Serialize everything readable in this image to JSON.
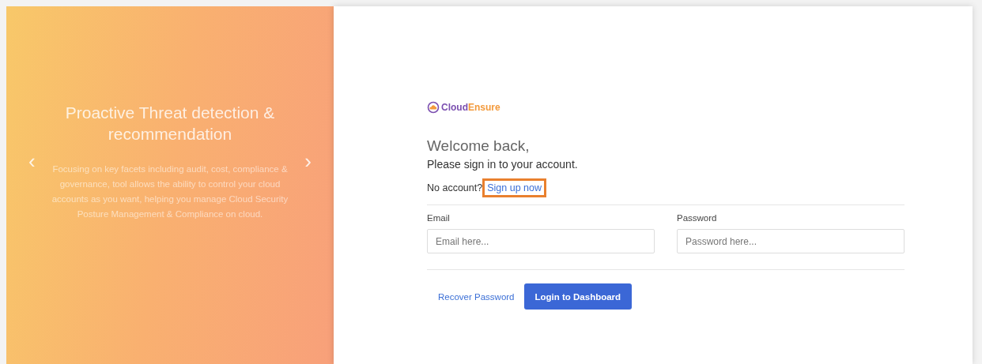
{
  "carousel": {
    "title": "Proactive Threat detection & recommendation",
    "text": "Focusing on key facets including audit, cost, compliance & governance, tool allows the ability to control your cloud accounts as you want, helping you manage Cloud Security Posture Management & Compliance on cloud.",
    "prev": "‹",
    "next": "›"
  },
  "logo": {
    "part_1": "Cloud",
    "part_2": "Ensure"
  },
  "heading": "Welcome back,",
  "subheading": "Please sign in to your account.",
  "signup": {
    "prompt": "No account?",
    "link": "Sign up now",
    "highlighted": true
  },
  "fields": [
    {
      "label": "Email",
      "placeholder": "Email here..."
    },
    {
      "label": "Password",
      "placeholder": "Password here..."
    }
  ],
  "recover_link": "Recover Password",
  "login_button": "Login to Dashboard"
}
